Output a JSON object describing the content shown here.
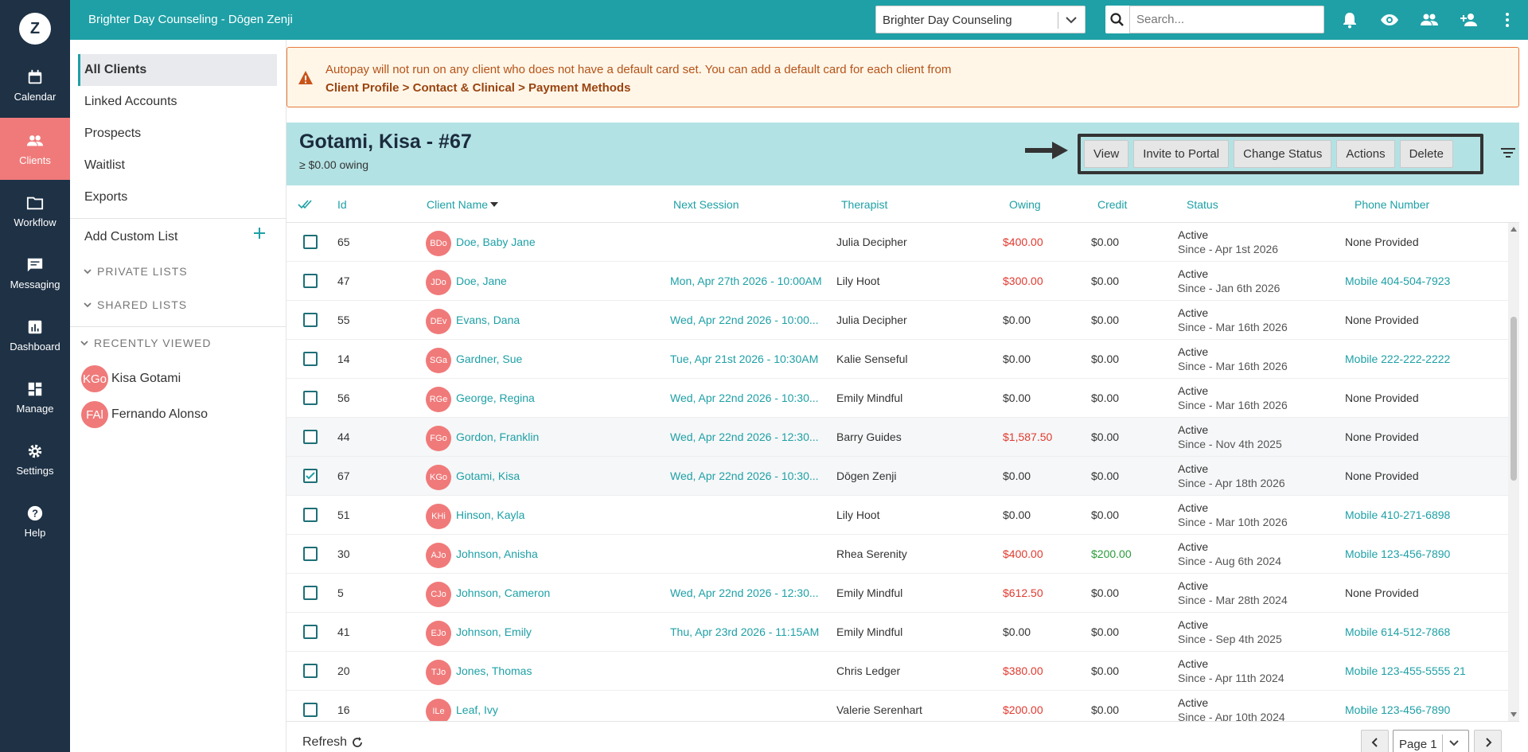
{
  "app": {
    "logo_letter": "Z",
    "title": "Brighter Day Counseling - Dōgen Zenji"
  },
  "nav": [
    {
      "label": "Calendar",
      "icon": "calendar-icon"
    },
    {
      "label": "Clients",
      "icon": "people-icon",
      "active": true
    },
    {
      "label": "Workflow",
      "icon": "folder-icon"
    },
    {
      "label": "Messaging",
      "icon": "message-icon"
    },
    {
      "label": "Dashboard",
      "icon": "chart-icon"
    },
    {
      "label": "Manage",
      "icon": "grid-icon"
    },
    {
      "label": "Settings",
      "icon": "gear-icon"
    },
    {
      "label": "Help",
      "icon": "help-icon"
    }
  ],
  "topbar": {
    "practice": "Brighter Day Counseling",
    "search_placeholder": "Search..."
  },
  "sidebar": {
    "lists": [
      "All Clients",
      "Linked Accounts",
      "Prospects",
      "Waitlist",
      "Exports"
    ],
    "add_custom": "Add Custom List",
    "private": "PRIVATE LISTS",
    "shared": "SHARED LISTS",
    "recent": "RECENTLY VIEWED",
    "recent_items": [
      {
        "initials": "KGo",
        "name": "Kisa Gotami"
      },
      {
        "initials": "FAl",
        "name": "Fernando Alonso"
      }
    ]
  },
  "banner": {
    "line1": "Autopay will not run on any client who does not have a default card set. You can add a default card for each client from",
    "line2": "Client Profile > Contact & Clinical > Payment Methods"
  },
  "client": {
    "name": "Gotami, Kisa - #67",
    "owing": "≥ $0.00 owing",
    "buttons": [
      "View",
      "Invite to Portal",
      "Change Status",
      "Actions",
      "Delete"
    ]
  },
  "table": {
    "headers": [
      "Id",
      "Client Name",
      "Next Session",
      "Therapist",
      "Owing",
      "Credit",
      "Status",
      "Phone Number"
    ],
    "rows": [
      {
        "id": "65",
        "initials": "BDo",
        "name": "Doe, Baby Jane",
        "next": "",
        "therapist": "Julia Decipher",
        "owing": "$400.00",
        "owing_red": true,
        "credit": "$0.00",
        "status": "Active",
        "since": "Since - Apr 1st 2026",
        "phone": "None Provided",
        "phone_link": false,
        "checked": false
      },
      {
        "id": "47",
        "initials": "JDo",
        "name": "Doe, Jane",
        "next": "Mon, Apr 27th 2026 - 10:00AM",
        "therapist": "Lily Hoot",
        "owing": "$300.00",
        "owing_red": true,
        "credit": "$0.00",
        "status": "Active",
        "since": "Since - Jan 6th 2026",
        "phone": "Mobile 404-504-7923",
        "phone_link": true,
        "checked": false
      },
      {
        "id": "55",
        "initials": "DEv",
        "name": "Evans, Dana",
        "next": "Wed, Apr 22nd 2026 - 10:00...",
        "therapist": "Julia Decipher",
        "owing": "$0.00",
        "owing_red": false,
        "credit": "$0.00",
        "status": "Active",
        "since": "Since - Mar 16th 2026",
        "phone": "None Provided",
        "phone_link": false,
        "checked": false
      },
      {
        "id": "14",
        "initials": "SGa",
        "name": "Gardner, Sue",
        "next": "Tue, Apr 21st 2026 - 10:30AM",
        "therapist": "Kalie Senseful",
        "owing": "$0.00",
        "owing_red": false,
        "credit": "$0.00",
        "status": "Active",
        "since": "Since - Mar 16th 2026",
        "phone": "Mobile 222-222-2222",
        "phone_link": true,
        "checked": false
      },
      {
        "id": "56",
        "initials": "RGe",
        "name": "George, Regina",
        "next": "Wed, Apr 22nd 2026 - 10:30...",
        "therapist": "Emily Mindful",
        "owing": "$0.00",
        "owing_red": false,
        "credit": "$0.00",
        "status": "Active",
        "since": "Since - Mar 16th 2026",
        "phone": "None Provided",
        "phone_link": false,
        "checked": false
      },
      {
        "id": "44",
        "initials": "FGo",
        "name": "Gordon, Franklin",
        "next": "Wed, Apr 22nd 2026 - 12:30...",
        "therapist": "Barry Guides",
        "owing": "$1,587.50",
        "owing_red": true,
        "credit": "$0.00",
        "status": "Active",
        "since": "Since - Nov 4th 2025",
        "phone": "None Provided",
        "phone_link": false,
        "checked": false
      },
      {
        "id": "67",
        "initials": "KGo",
        "name": "Gotami, Kisa",
        "next": "Wed, Apr 22nd 2026 - 10:30...",
        "therapist": "Dōgen Zenji",
        "owing": "$0.00",
        "owing_red": false,
        "credit": "$0.00",
        "status": "Active",
        "since": "Since - Apr 18th 2026",
        "phone": "None Provided",
        "phone_link": false,
        "checked": true
      },
      {
        "id": "51",
        "initials": "KHi",
        "name": "Hinson, Kayla",
        "next": "",
        "therapist": "Lily Hoot",
        "owing": "$0.00",
        "owing_red": false,
        "credit": "$0.00",
        "status": "Active",
        "since": "Since - Mar 10th 2026",
        "phone": "Mobile 410-271-6898",
        "phone_link": true,
        "checked": false
      },
      {
        "id": "30",
        "initials": "AJo",
        "name": "Johnson, Anisha",
        "next": "",
        "therapist": "Rhea Serenity",
        "owing": "$400.00",
        "owing_red": true,
        "credit": "$200.00",
        "credit_green": true,
        "status": "Active",
        "since": "Since - Aug 6th 2024",
        "phone": "Mobile 123-456-7890",
        "phone_link": true,
        "checked": false
      },
      {
        "id": "5",
        "initials": "CJo",
        "name": "Johnson, Cameron",
        "next": "Wed, Apr 22nd 2026 - 12:30...",
        "therapist": "Emily Mindful",
        "owing": "$612.50",
        "owing_red": true,
        "credit": "$0.00",
        "status": "Active",
        "since": "Since - Mar 28th 2024",
        "phone": "None Provided",
        "phone_link": false,
        "checked": false
      },
      {
        "id": "41",
        "initials": "EJo",
        "name": "Johnson, Emily",
        "next": "Thu, Apr 23rd 2026 - 11:15AM",
        "therapist": "Emily Mindful",
        "owing": "$0.00",
        "owing_red": false,
        "credit": "$0.00",
        "status": "Active",
        "since": "Since - Sep 4th 2025",
        "phone": "Mobile 614-512-7868",
        "phone_link": true,
        "checked": false
      },
      {
        "id": "20",
        "initials": "TJo",
        "name": "Jones, Thomas",
        "next": "",
        "therapist": "Chris Ledger",
        "owing": "$380.00",
        "owing_red": true,
        "credit": "$0.00",
        "status": "Active",
        "since": "Since - Apr 11th 2024",
        "phone": "Mobile 123-455-5555 21",
        "phone_link": true,
        "checked": false
      },
      {
        "id": "16",
        "initials": "ILe",
        "name": "Leaf, Ivy",
        "next": "",
        "therapist": "Valerie Serenhart",
        "owing": "$200.00",
        "owing_red": true,
        "credit": "$0.00",
        "status": "Active",
        "since": "Since - Apr 10th 2024",
        "phone": "Mobile 123-456-7890",
        "phone_link": true,
        "checked": false
      }
    ]
  },
  "footer": {
    "refresh": "Refresh",
    "page": "Page 1"
  },
  "colors": {
    "teal": "#1ea0a6",
    "navy": "#1e3145",
    "coral": "#f07a7a",
    "owing_red": "#e03a2f"
  }
}
